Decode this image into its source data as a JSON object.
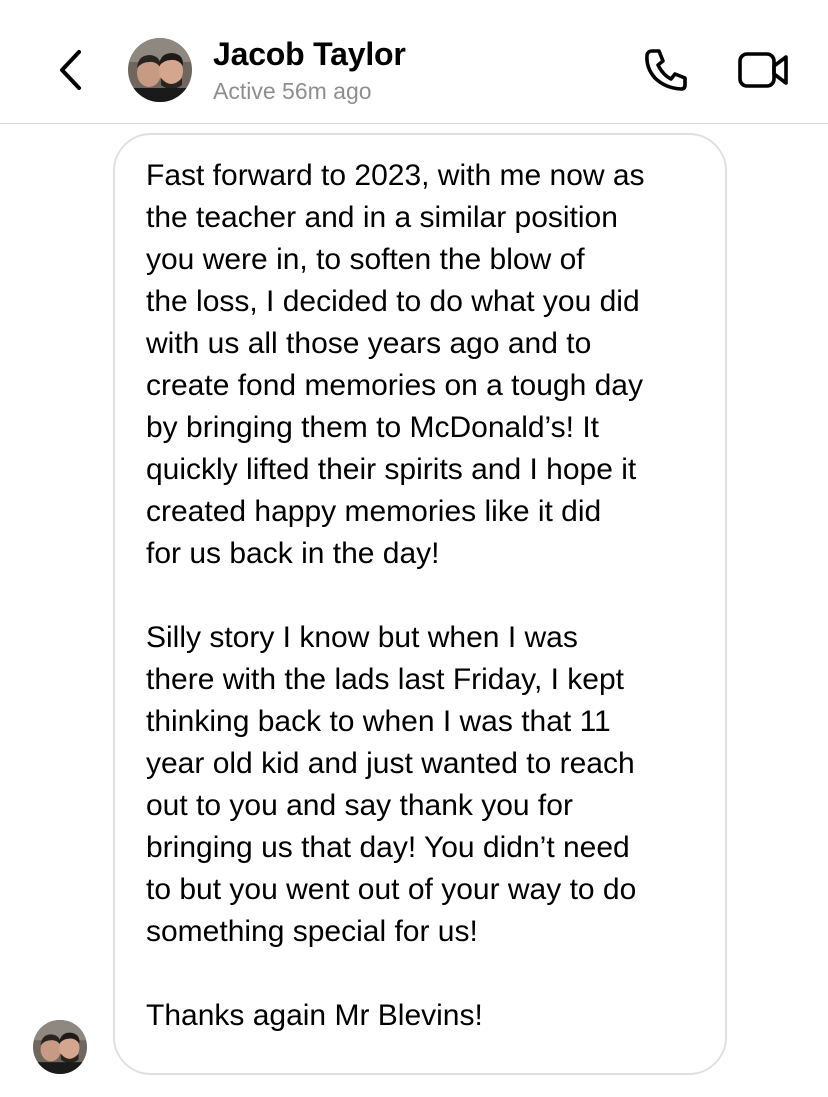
{
  "header": {
    "contact_name": "Jacob Taylor",
    "status": "Active 56m ago",
    "back_icon": "chevron-left-icon",
    "call_icon": "phone-icon",
    "video_icon": "video-camera-icon"
  },
  "message": {
    "paragraphs": [
      "Fast forward to 2023, with me now as\nthe teacher and in a similar position\nyou were in,  to soften the blow of\nthe loss, I decided to do what you did\nwith us all those years ago and to\ncreate fond memories on a tough day\nby bringing them to McDonald’s! It\nquickly lifted their spirits and I hope it\ncreated happy memories like it did\nfor us back in the day!",
      "Silly story I know but when I was\nthere with the lads last Friday, I kept\nthinking back to when I was that 11\nyear old kid and just wanted to reach\nout to you and say thank you for\nbringing us that day! You didn’t need\nto but you went out of your way to do\nsomething special for us!",
      "Thanks again Mr Blevins!"
    ]
  },
  "colors": {
    "status_text": "#8e8e8e",
    "bubble_border": "#e0e0e0",
    "divider": "#dbdbdb"
  }
}
